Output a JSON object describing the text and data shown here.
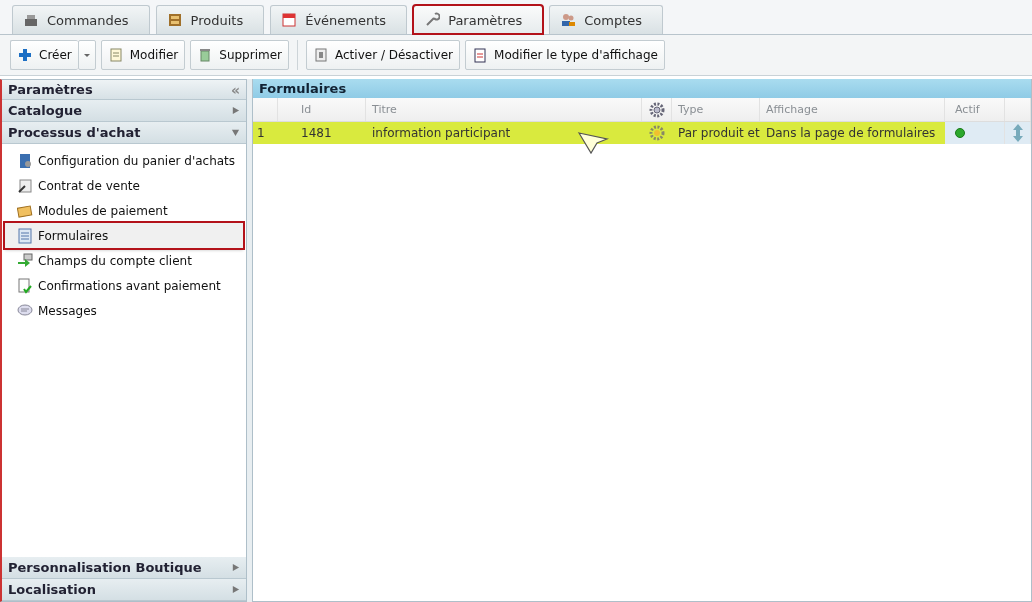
{
  "tabs": [
    {
      "label": "Commandes",
      "selected": false
    },
    {
      "label": "Produits",
      "selected": false
    },
    {
      "label": "Événements",
      "selected": false
    },
    {
      "label": "Paramètres",
      "selected": true
    },
    {
      "label": "Comptes",
      "selected": false
    }
  ],
  "toolbar": {
    "groups": [
      [
        {
          "label": "Créer",
          "kind": "split"
        },
        {
          "label": "Modifier",
          "kind": "plain"
        },
        {
          "label": "Supprimer",
          "kind": "plain"
        }
      ],
      [
        {
          "label": "Activer / Désactiver",
          "kind": "plain"
        },
        {
          "label": "Modifier le type d'affichage",
          "kind": "plain"
        }
      ]
    ]
  },
  "sidebar": {
    "title": "Paramètres",
    "collapse": "«",
    "sections": [
      {
        "label": "Catalogue",
        "expanded": false
      },
      {
        "label": "Processus d'achat",
        "expanded": true,
        "items": [
          {
            "label": "Configuration du panier d'achats",
            "selected": false
          },
          {
            "label": "Contrat de vente",
            "selected": false
          },
          {
            "label": "Modules de paiement",
            "selected": false
          },
          {
            "label": "Formulaires",
            "selected": true
          },
          {
            "label": "Champs du compte client",
            "selected": false
          },
          {
            "label": "Confirmations avant paiement",
            "selected": false
          },
          {
            "label": "Messages",
            "selected": false
          }
        ]
      }
    ],
    "bottom_sections": [
      {
        "label": "Personnalisation Boutique",
        "expanded": false
      },
      {
        "label": "Localisation",
        "expanded": false
      }
    ]
  },
  "grid": {
    "title": "Formulaires",
    "columns": [
      "Id",
      "Titre",
      "Type",
      "Affichage",
      "Actif"
    ],
    "rows": [
      {
        "number": "1",
        "id": "1481",
        "title": "information participant",
        "type": "Par produit et",
        "display": "Dans la page de formulaires",
        "active": true,
        "selected": true
      }
    ]
  }
}
